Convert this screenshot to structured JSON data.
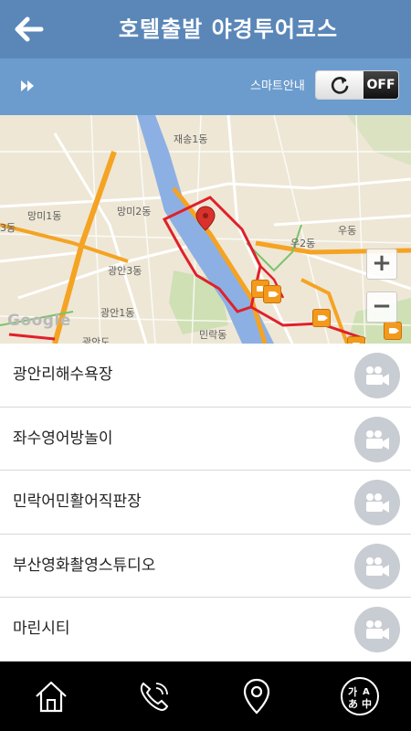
{
  "header": {
    "title": "호텔출발 야경투어코스",
    "back_icon": "arrow-left-icon"
  },
  "subbar": {
    "play_icon": "fast-forward-icon",
    "smart_label": "스마트안내",
    "toggle_state": "OFF",
    "toggle_icon": "refresh-icon"
  },
  "map": {
    "attribution": "Google",
    "zoom_in": "+",
    "zoom_out": "−",
    "labels": {
      "jaesong": "재송1동",
      "mangmi1": "망미1동",
      "mangmi2": "망미2동",
      "gwangan3": "광안3동",
      "gwangan1": "광안1동",
      "gwangando": "광안도",
      "u2": "우2동",
      "udong": "우동",
      "minrak": "민락동",
      "dong3": "3동"
    },
    "colors": {
      "route": "#e0202a",
      "river": "#8cb0e3",
      "highway": "#f5a323",
      "poi": "#f39a1c"
    }
  },
  "list": {
    "items": [
      {
        "label": "광안리해수욕장",
        "icon": "video-camera-icon"
      },
      {
        "label": "좌수영어방놀이",
        "icon": "video-camera-icon"
      },
      {
        "label": "민락어민활어직판장",
        "icon": "video-camera-icon"
      },
      {
        "label": "부산영화촬영스튜디오",
        "icon": "video-camera-icon"
      },
      {
        "label": "마린시티",
        "icon": "video-camera-icon"
      }
    ]
  },
  "bottom_nav": {
    "items": [
      {
        "name": "home",
        "icon": "home-icon"
      },
      {
        "name": "call",
        "icon": "phone-icon"
      },
      {
        "name": "location",
        "icon": "location-pin-icon"
      },
      {
        "name": "language",
        "icon": "language-icon",
        "glyphs": [
          "가",
          "A",
          "あ",
          "中"
        ]
      }
    ]
  }
}
